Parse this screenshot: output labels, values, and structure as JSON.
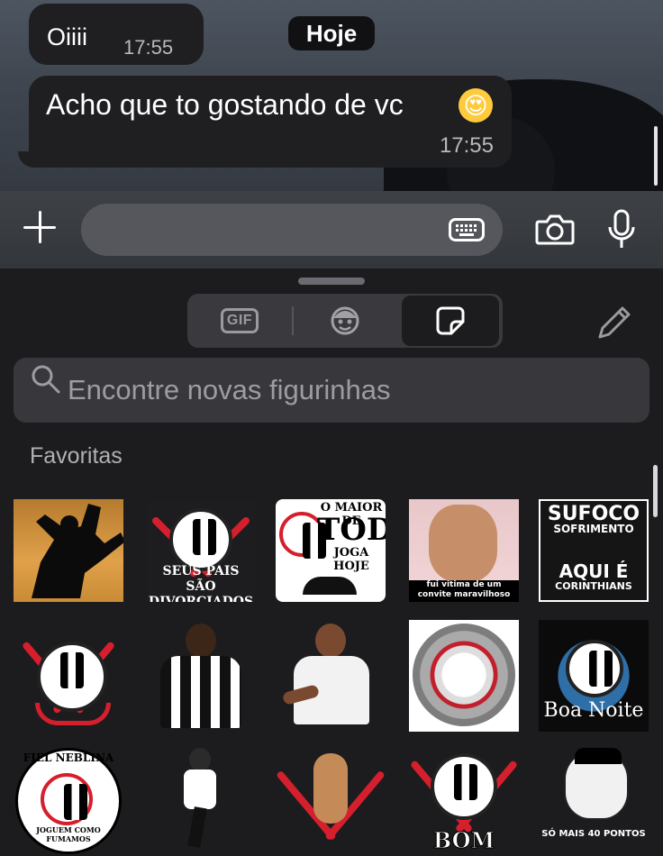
{
  "chat": {
    "date_chip": "Hoje",
    "messages": [
      {
        "text": "Oiiii",
        "time": "17:55"
      },
      {
        "text": "Acho que to gostando de vc",
        "emoji": "😍",
        "time": "17:55"
      }
    ]
  },
  "input_bar": {
    "attach_icon": "plus-icon",
    "keyboard_icon": "keyboard-icon",
    "camera_icon": "camera-icon",
    "mic_icon": "microphone-icon"
  },
  "sticker_panel": {
    "tabs": [
      {
        "label": "GIF",
        "icon": "gif-icon"
      },
      {
        "icon": "avatar-icon"
      },
      {
        "icon": "sticker-icon",
        "selected": true
      }
    ],
    "edit_icon": "pencil-icon",
    "search": {
      "placeholder": "Encontre novas figurinhas"
    },
    "section_title": "Favoritas",
    "stickers": [
      {
        "name": "silhouette-sticker",
        "caption": ""
      },
      {
        "name": "seus-pais-sticker",
        "caption": "SEUS PAIS SÃO DIVORCIADOS"
      },
      {
        "name": "maior-de-todos-sticker",
        "caption_top": "O MAIOR DE",
        "caption_mid": "TODOS",
        "caption_bottom": "JOGA HOJE"
      },
      {
        "name": "fui-vitima-sticker",
        "caption": "fui vitima de um convite maravilhoso"
      },
      {
        "name": "sufoco-sticker",
        "caption_top": "SUFOCO",
        "caption_top2": "SOFRIMENTO",
        "caption_bottom": "AQUI É",
        "caption_bottom2": "CORINTHIANS"
      },
      {
        "name": "corinthians-crest-sticker",
        "caption": ""
      },
      {
        "name": "player-sticker",
        "caption": ""
      },
      {
        "name": "player-pointing-sticker",
        "caption": ""
      },
      {
        "name": "ball-sticker",
        "caption": ""
      },
      {
        "name": "boa-noite-sticker",
        "caption": "Boa Noite"
      },
      {
        "name": "fiel-nebulina-sticker",
        "caption_top": "FIEL NEBLINA",
        "caption_bottom": "JOGUEM COMO FUMAMOS"
      },
      {
        "name": "kick-sticker",
        "caption": ""
      },
      {
        "name": "crest-figure-sticker",
        "caption": ""
      },
      {
        "name": "bom-dia-sticker",
        "caption": "BOM DIA..."
      },
      {
        "name": "so-mais-40-sticker",
        "caption": "SÓ MAIS 40 PONTOS"
      }
    ]
  },
  "colors": {
    "bubble": "#1f1f22",
    "panel": "#1c1c1e",
    "corinthians_red": "#d51f2d"
  }
}
